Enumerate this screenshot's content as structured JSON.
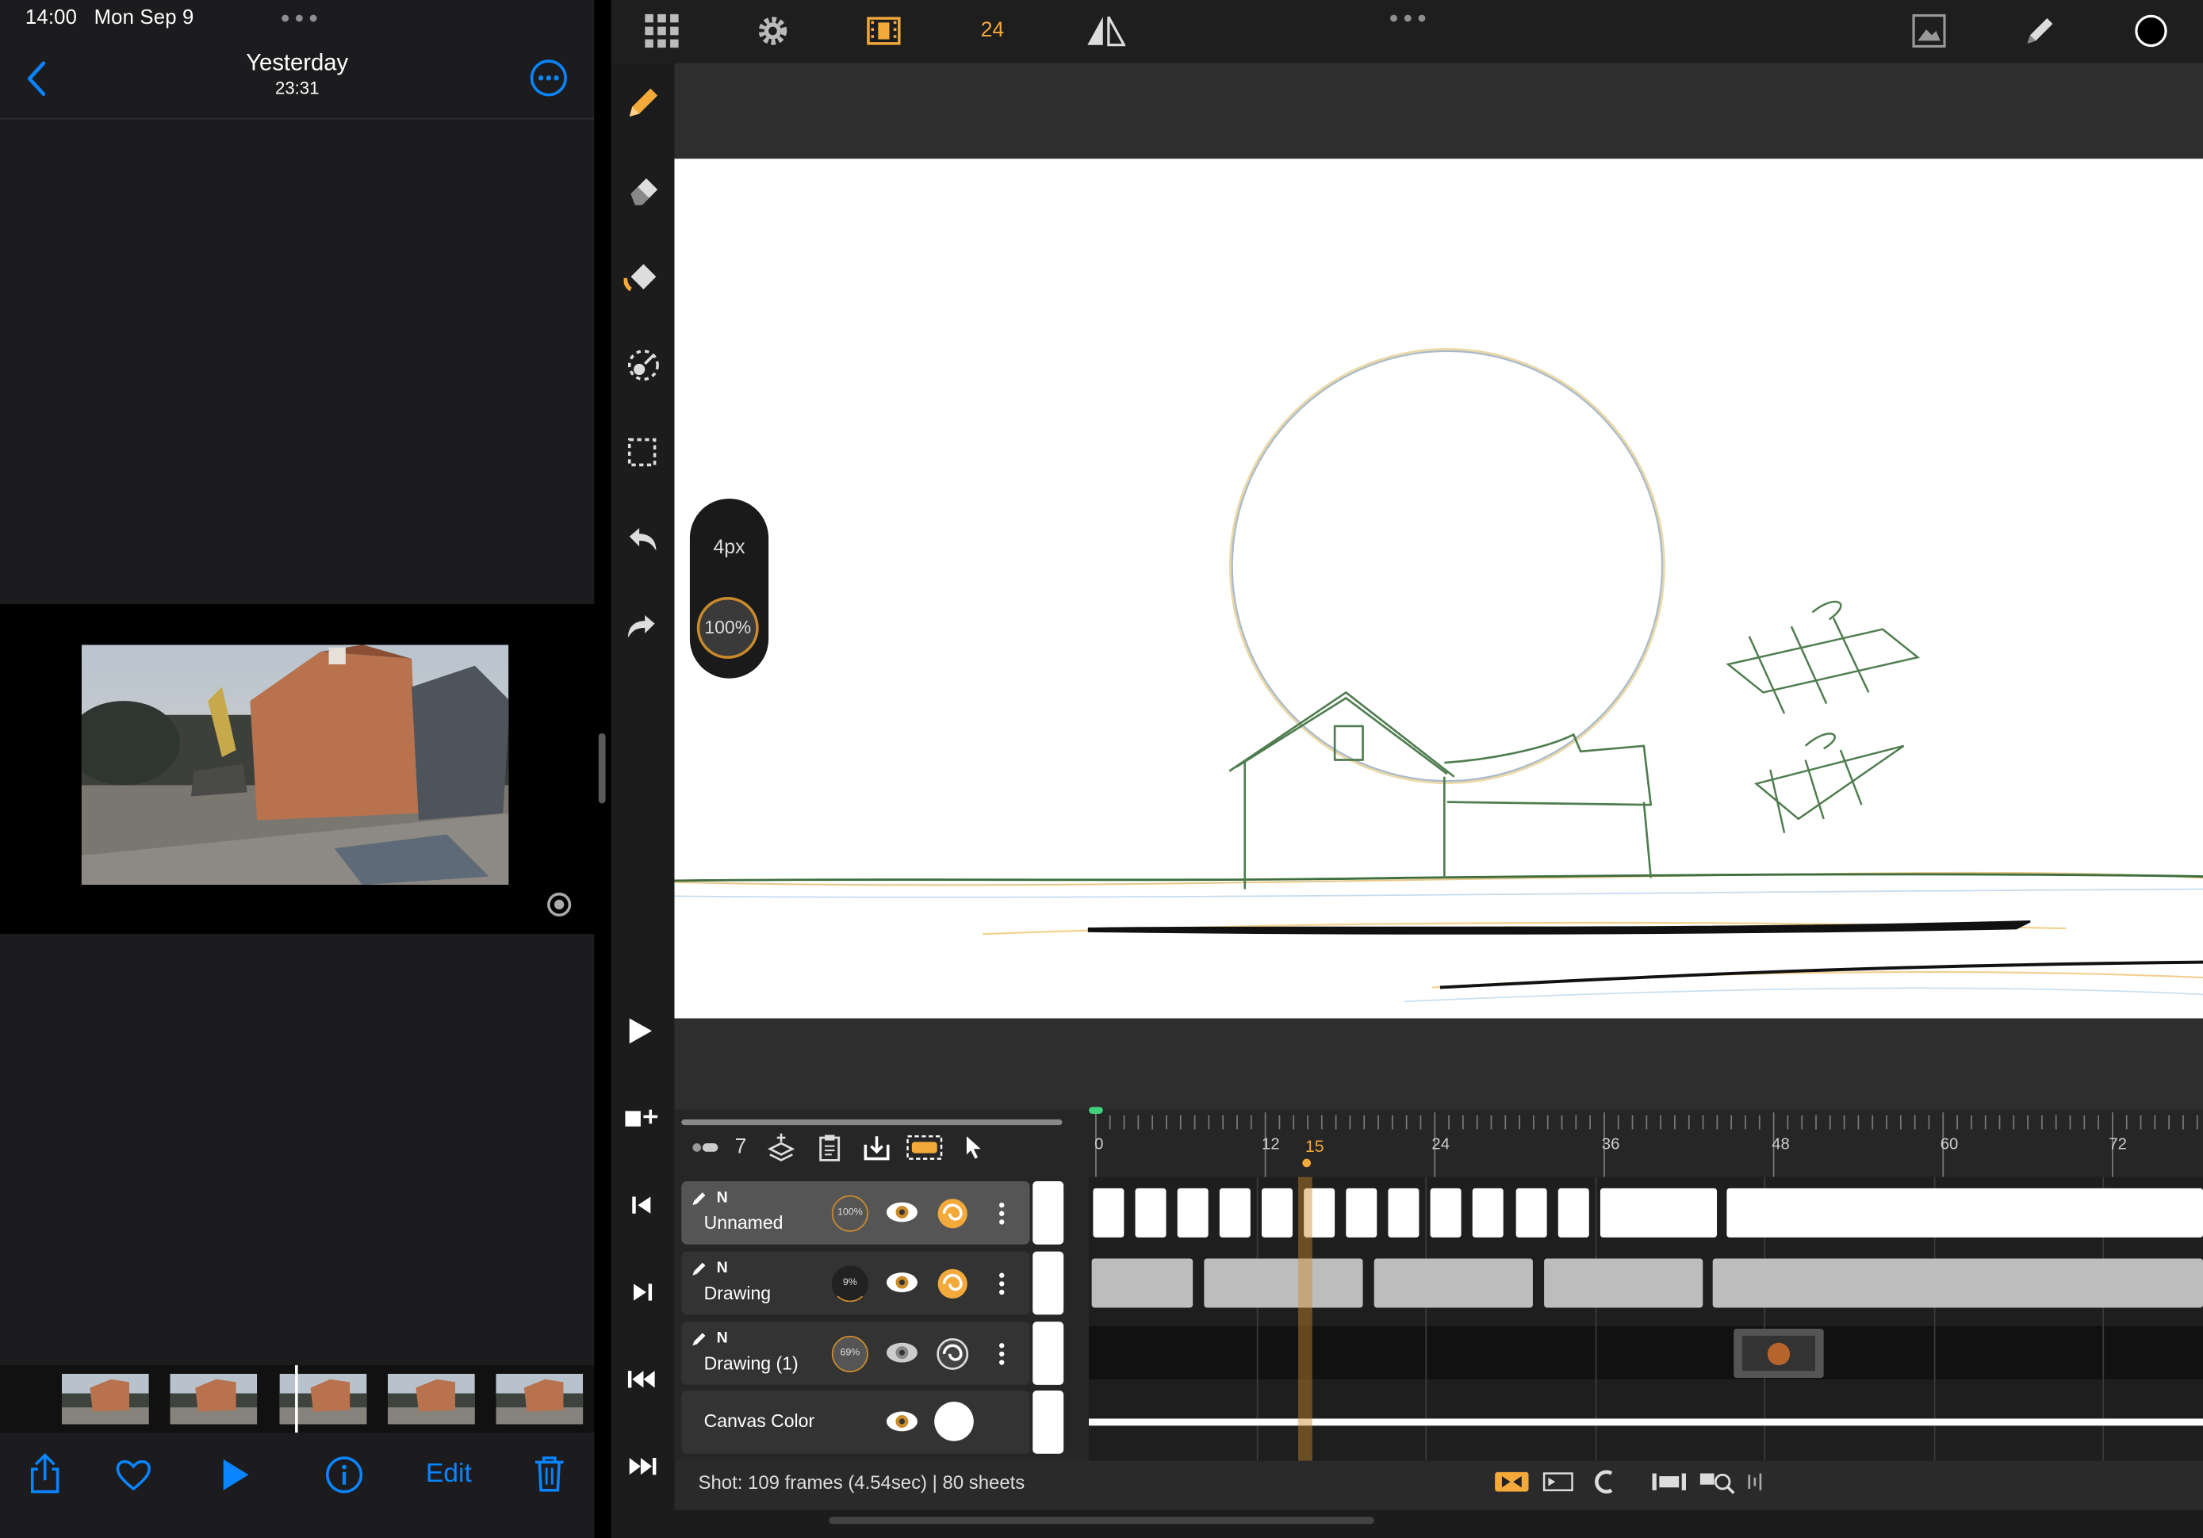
{
  "status_bar": {
    "time": "14:00",
    "date": "Mon Sep 9"
  },
  "photos": {
    "title": "Yesterday",
    "subtitle": "23:31",
    "edit_label": "Edit",
    "icons": [
      "back-chevron-icon",
      "more-options-icon",
      "share-icon",
      "heart-icon",
      "play-icon",
      "info-icon",
      "trash-icon",
      "live-photo-icon"
    ]
  },
  "app": {
    "fps": "24",
    "toolbar_icons": [
      "gallery-grid-icon",
      "settings-gear-icon",
      "film-frames-icon",
      "flip-mirror-icon",
      "more-icon",
      "image-reference-icon",
      "pen-icon",
      "color-swatch-icon"
    ],
    "tools": [
      "pencil-tool",
      "eraser-tool",
      "fill-bucket-tool",
      "lasso-transform-tool",
      "selection-rect-tool",
      "undo",
      "redo"
    ],
    "brush": {
      "size": "4px",
      "opacity": "100%"
    },
    "layers_header": {
      "count": "7"
    },
    "layers": [
      {
        "badge": "N",
        "name": "Unnamed",
        "opacity": "100%",
        "selected": true
      },
      {
        "badge": "N",
        "name": "Drawing",
        "opacity": "9%",
        "selected": false
      },
      {
        "badge": "N",
        "name": "Drawing (1)",
        "opacity": "69%",
        "selected": false
      }
    ],
    "canvas_color_label": "Canvas Color",
    "timeline": {
      "ticks": [
        "0",
        "12",
        "24",
        "36",
        "48",
        "60",
        "72"
      ],
      "current_frame": "15"
    },
    "shot_info": "Shot: 109 frames (4.54sec) | 80 sheets",
    "accent_color": "#f4a93b"
  }
}
